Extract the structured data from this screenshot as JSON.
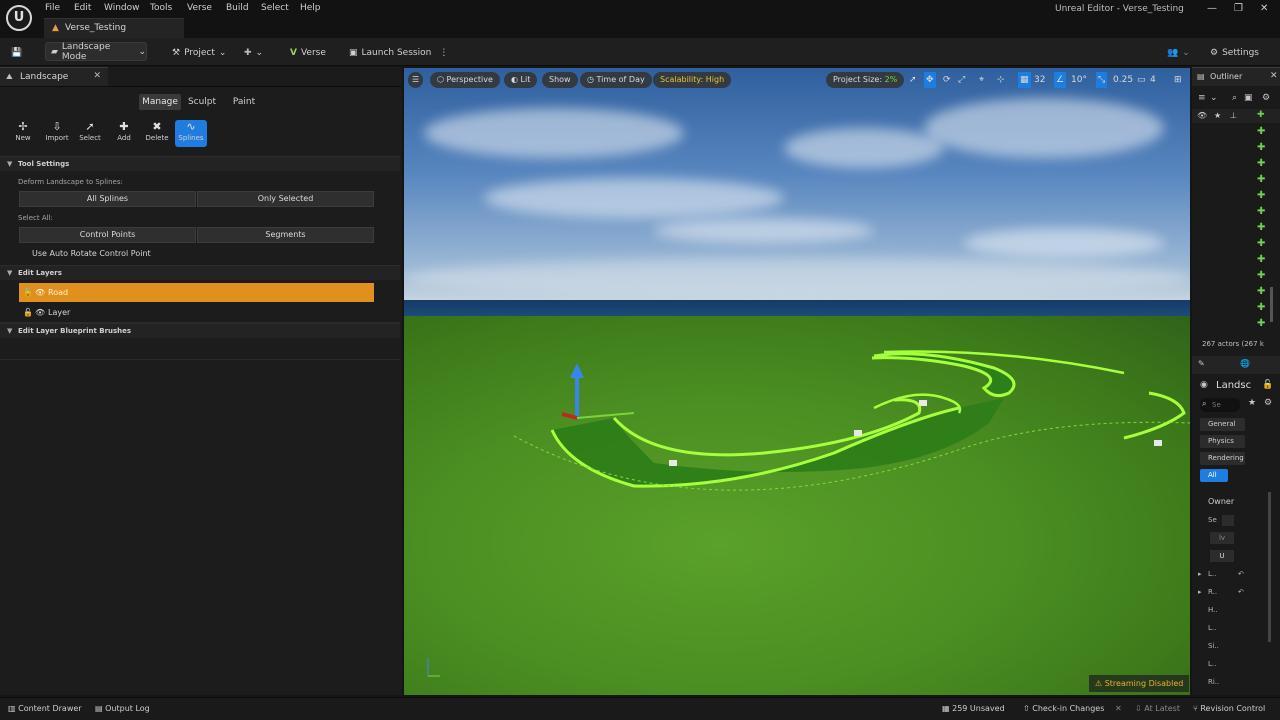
{
  "window": {
    "title": "Unreal Editor - Verse_Testing",
    "level_tab": "Verse_Testing",
    "menu": [
      "File",
      "Edit",
      "Window",
      "Tools",
      "Verse",
      "Build",
      "Select",
      "Help"
    ],
    "logo_text": "U"
  },
  "toolbar": {
    "mode": "Landscape Mode",
    "project": "Project",
    "verse": "Verse",
    "launch_session": "Launch Session",
    "settings": "Settings"
  },
  "landscape_panel": {
    "tab_label": "Landscape",
    "mode_tabs": [
      "Manage",
      "Sculpt",
      "Paint"
    ],
    "selected_mode": "Manage",
    "tools": [
      {
        "label": "New",
        "icon": "new-icon"
      },
      {
        "label": "Import",
        "icon": "import-icon"
      },
      {
        "label": "Select",
        "icon": "select-icon"
      },
      {
        "label": "Add",
        "icon": "add-icon"
      },
      {
        "label": "Delete",
        "icon": "delete-icon"
      },
      {
        "label": "Splines",
        "icon": "splines-icon"
      }
    ],
    "active_tool": "Splines",
    "tool_settings": {
      "header": "Tool Settings",
      "deform_label": "Deform Landscape to Splines:",
      "all_splines": "All Splines",
      "only_selected": "Only Selected",
      "select_all_label": "Select All:",
      "control_points": "Control Points",
      "segments": "Segments",
      "auto_rotate_label": "Use Auto Rotate Control Point",
      "auto_rotate_checked": true
    },
    "edit_layers": {
      "header": "Edit Layers",
      "layers": [
        {
          "name": "Road",
          "selected": true
        },
        {
          "name": "Layer",
          "selected": false
        }
      ]
    },
    "blueprint_brushes_header": "Edit Layer Blueprint Brushes"
  },
  "viewport": {
    "perspective": "Perspective",
    "lit": "Lit",
    "show": "Show",
    "time_of_day": "Time of Day",
    "scalability": "Scalability: High",
    "project_size_label": "Project Size:",
    "project_size_value": "2%",
    "grid_snap": "32",
    "rotation_snap": "10°",
    "scale_snap": "0.25",
    "camera_speed": "4",
    "streaming": "Streaming Disabled"
  },
  "outliner": {
    "tab_label": "Outliner",
    "actor_count": "267 actors (267 k",
    "details_title": "Landsc",
    "search_placeholder": "Se",
    "filters": [
      "General",
      "Physics",
      "Rendering",
      "All"
    ],
    "active_filter": "All",
    "owner_label": "Owner",
    "rows": [
      "Se",
      "L..",
      "R..",
      "H..",
      "L..",
      "Si..",
      "L..",
      "Ri.."
    ],
    "u_button": "U",
    "lv_button": "lv"
  },
  "statusbar": {
    "content_drawer": "Content Drawer",
    "output_log": "Output Log",
    "unsaved": "259 Unsaved",
    "check_in": "Check-in Changes",
    "at_latest": "At Latest",
    "revision_control": "Revision Control"
  },
  "colors": {
    "accent_blue": "#1f7de0",
    "layer_selected": "#e0901c",
    "spline_green": "#9dff3a",
    "warning_yellow": "#e4b32a"
  }
}
